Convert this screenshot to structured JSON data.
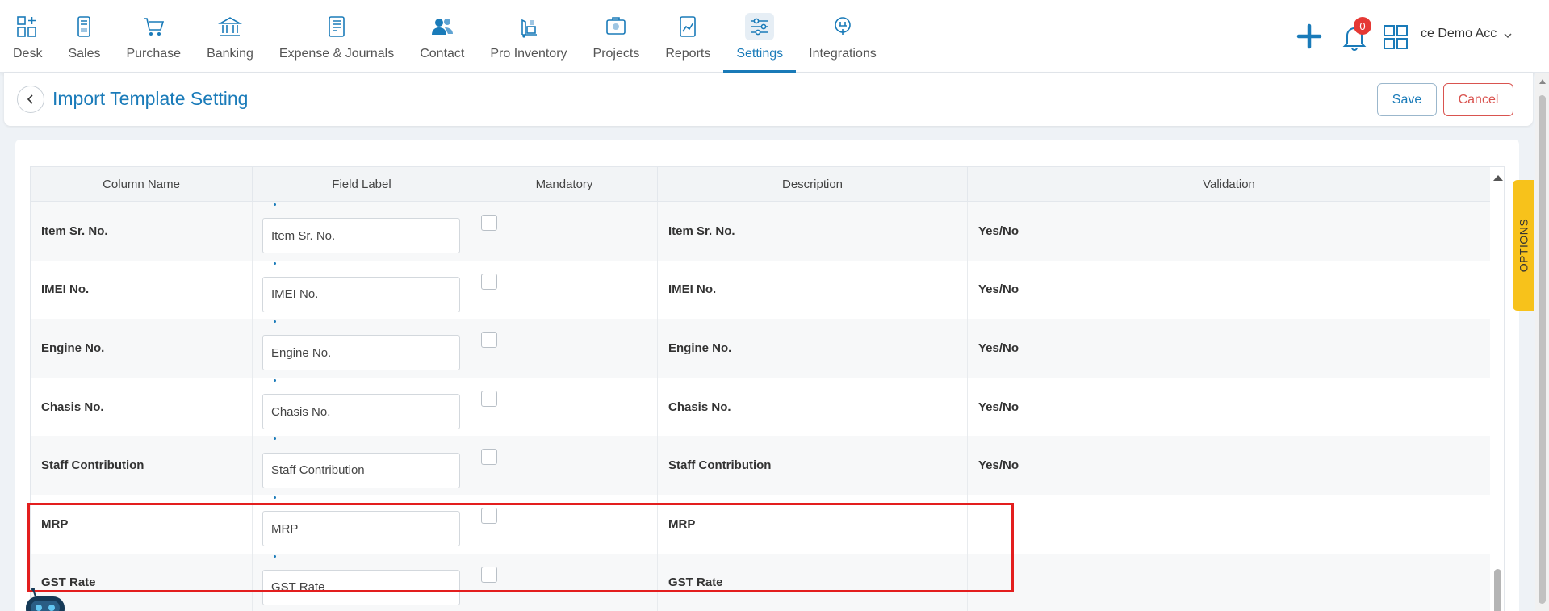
{
  "nav": {
    "items": [
      {
        "label": "Desk",
        "icon": "desk-icon"
      },
      {
        "label": "Sales",
        "icon": "sales-icon"
      },
      {
        "label": "Purchase",
        "icon": "cart-icon"
      },
      {
        "label": "Banking",
        "icon": "bank-icon"
      },
      {
        "label": "Expense & Journals",
        "icon": "journal-icon"
      },
      {
        "label": "Contact",
        "icon": "contacts-icon"
      },
      {
        "label": "Pro Inventory",
        "icon": "inventory-icon"
      },
      {
        "label": "Projects",
        "icon": "projects-icon"
      },
      {
        "label": "Reports",
        "icon": "reports-icon"
      },
      {
        "label": "Settings",
        "icon": "settings-sliders-icon",
        "active": true
      },
      {
        "label": "Integrations",
        "icon": "integrations-icon"
      }
    ],
    "notification_count": "0",
    "account_label": "ce Demo Acc"
  },
  "header": {
    "title": "Import Template Setting",
    "save_label": "Save",
    "cancel_label": "Cancel"
  },
  "table": {
    "columns": [
      "Column Name",
      "Field Label",
      "Mandatory",
      "Description",
      "Validation"
    ],
    "rows": [
      {
        "column_name": "Item Sr. No.",
        "field_label": "Item Sr. No.",
        "description": "Item Sr. No.",
        "validation": "Yes/No"
      },
      {
        "column_name": "IMEI No.",
        "field_label": "IMEI No.",
        "description": "IMEI No.",
        "validation": "Yes/No"
      },
      {
        "column_name": "Engine No.",
        "field_label": "Engine No.",
        "description": "Engine No.",
        "validation": "Yes/No"
      },
      {
        "column_name": "Chasis No.",
        "field_label": "Chasis No.",
        "description": "Chasis No.",
        "validation": "Yes/No"
      },
      {
        "column_name": "Staff Contribution",
        "field_label": "Staff Contribution",
        "description": "Staff Contribution",
        "validation": "Yes/No"
      },
      {
        "column_name": "MRP",
        "field_label": "MRP",
        "description": "MRP",
        "validation": ""
      },
      {
        "column_name": "GST Rate",
        "field_label": "GST Rate",
        "description": "GST Rate",
        "validation": ""
      }
    ]
  },
  "options_tab_label": "OPTIONS",
  "colors": {
    "accent": "#1a7bb9",
    "cancel": "#d9534f",
    "highlight": "#e31e1e",
    "options_tab": "#f7c21b",
    "badge": "#e53935"
  }
}
